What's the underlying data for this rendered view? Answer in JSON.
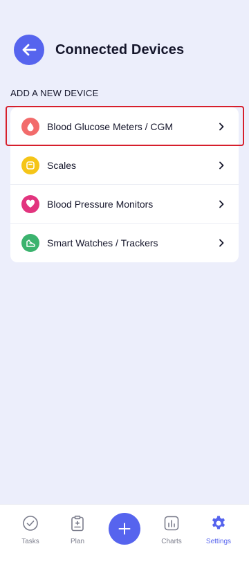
{
  "header": {
    "title": "Connected Devices",
    "back_icon": "arrow-left-icon"
  },
  "section": {
    "label": "ADD A NEW DEVICE"
  },
  "devices": [
    {
      "label": "Blood Glucose Meters / CGM",
      "icon": "blood-drop-icon",
      "color": "#f26b6b"
    },
    {
      "label": "Scales",
      "icon": "scale-icon",
      "color": "#f5c518"
    },
    {
      "label": "Blood Pressure Monitors",
      "icon": "heart-icon",
      "color": "#e2347e"
    },
    {
      "label": "Smart Watches / Trackers",
      "icon": "running-shoe-icon",
      "color": "#3bb36e"
    }
  ],
  "nav": {
    "tasks": "Tasks",
    "plan": "Plan",
    "charts": "Charts",
    "settings": "Settings",
    "active": "Settings"
  },
  "colors": {
    "accent": "#5664ee",
    "background": "#eceefb",
    "highlight": "#d61f2c"
  }
}
